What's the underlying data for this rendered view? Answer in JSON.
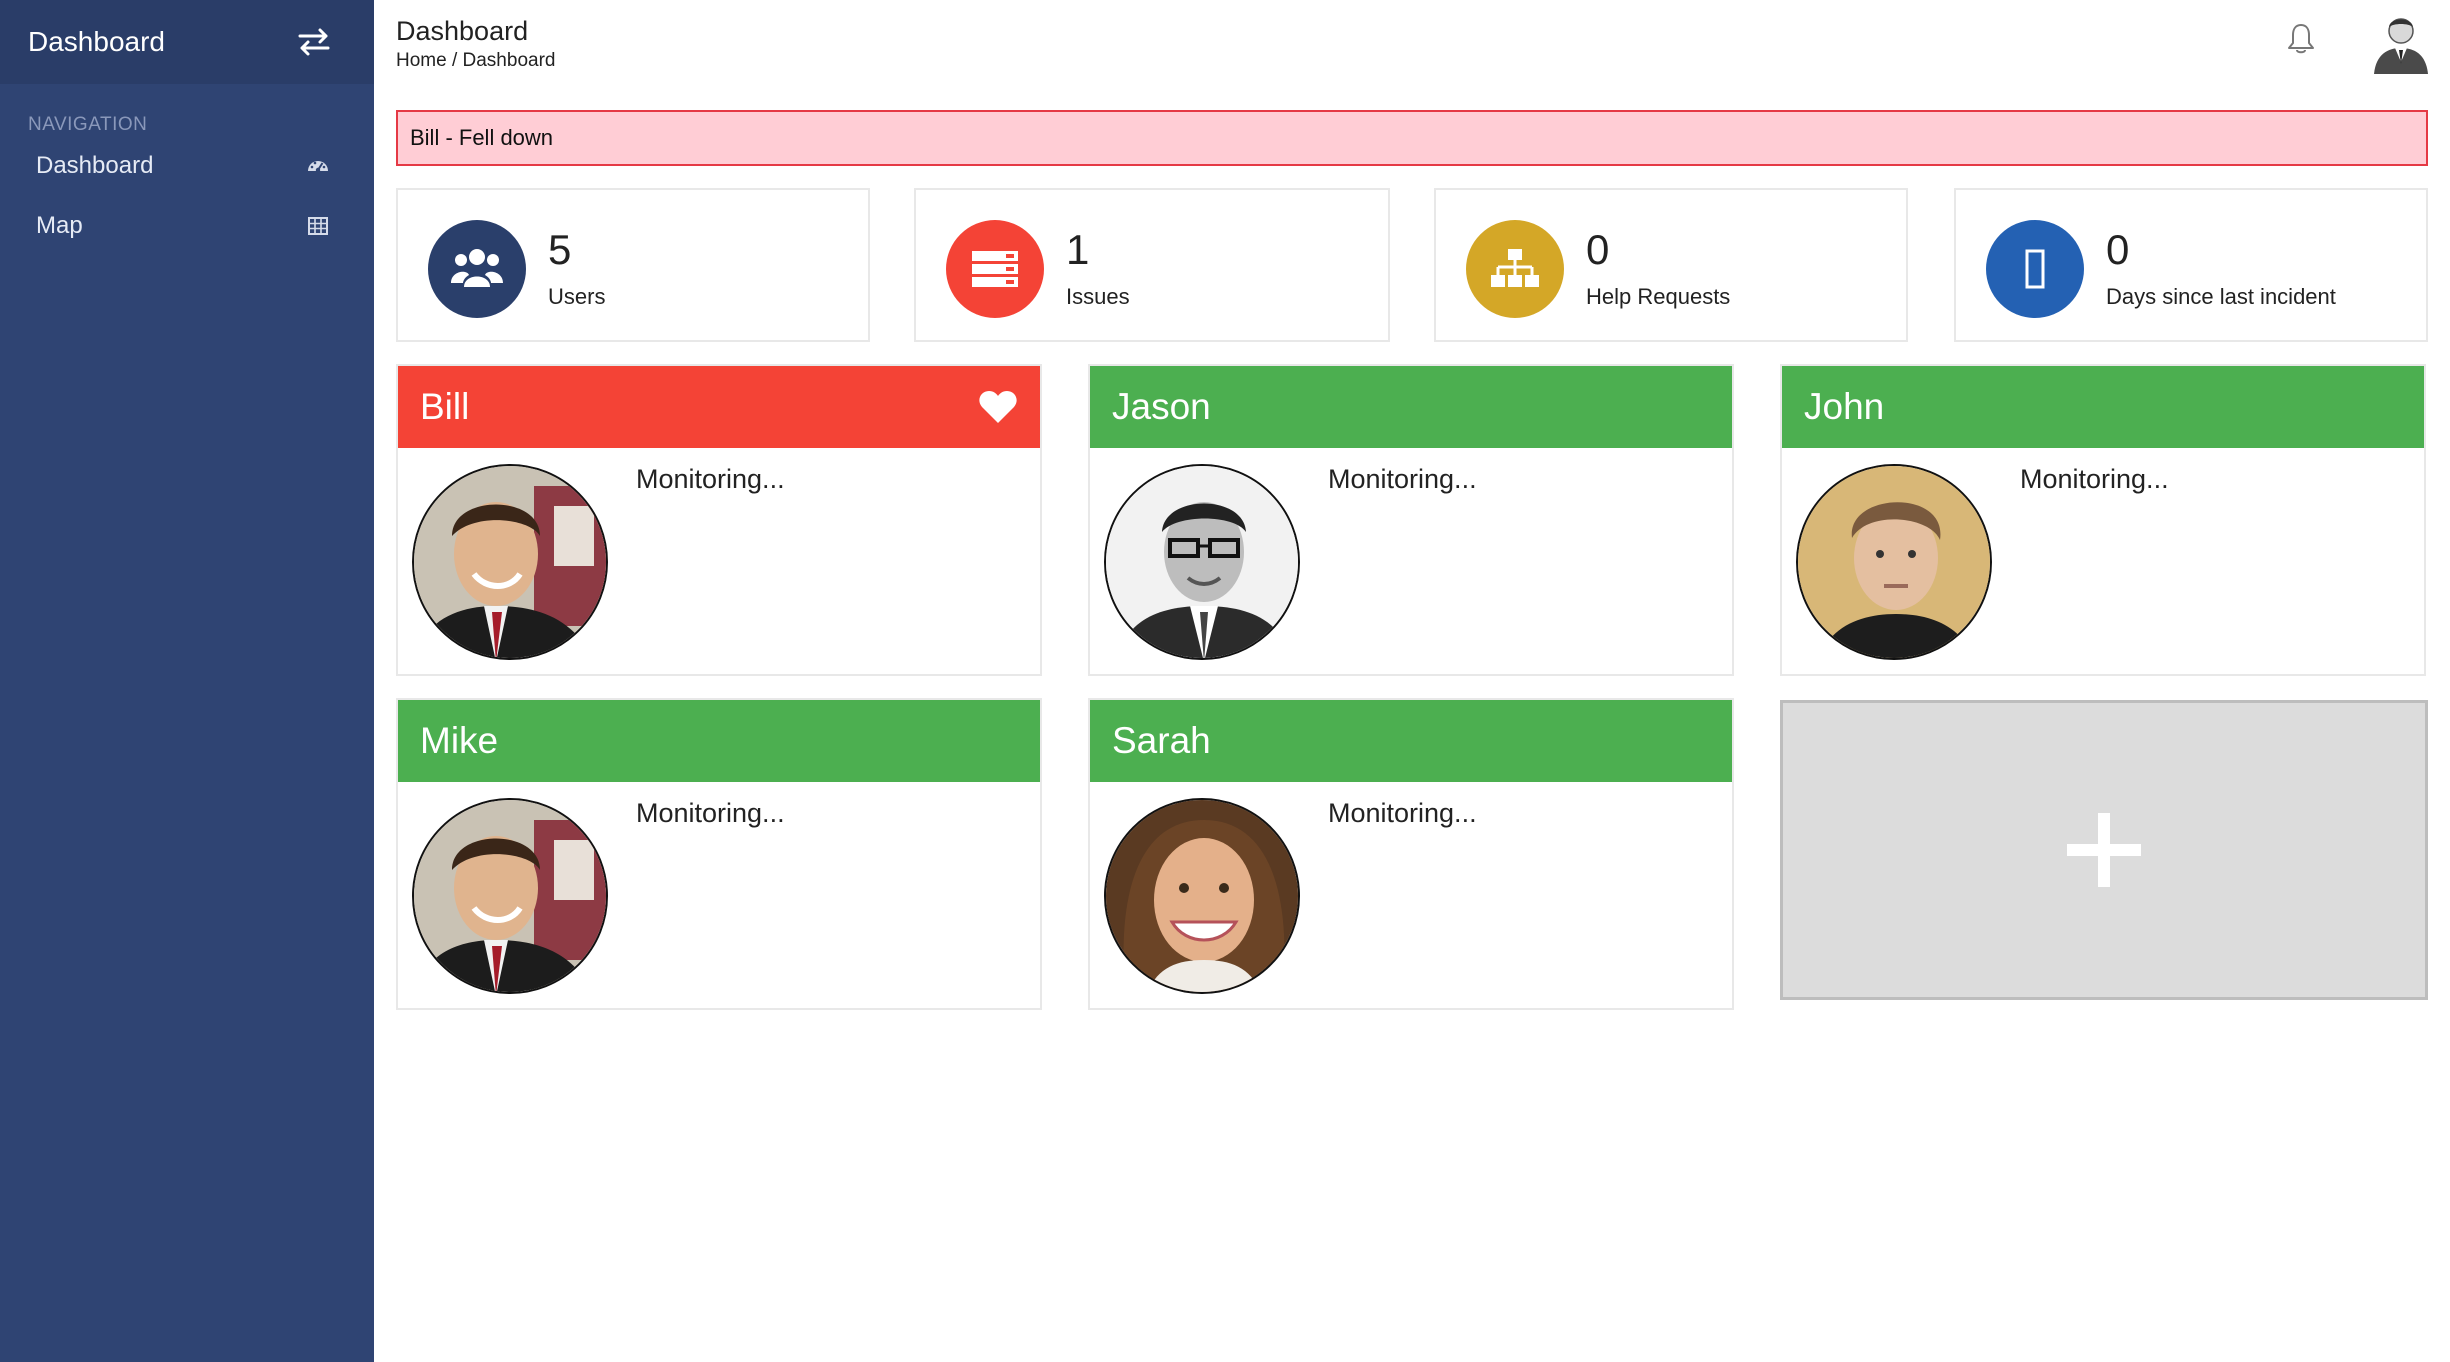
{
  "sidebar": {
    "title": "Dashboard",
    "section": "NAVIGATION",
    "items": [
      {
        "label": "Dashboard",
        "icon": "dashboard-gauge-icon"
      },
      {
        "label": "Map",
        "icon": "grid-table-icon"
      }
    ]
  },
  "header": {
    "title": "Dashboard",
    "breadcrumb": "Home / Dashboard"
  },
  "alert": {
    "text": "Bill - Fell down"
  },
  "stats": [
    {
      "value": "5",
      "label": "Users",
      "icon": "users-icon",
      "color": "#2a3f6b"
    },
    {
      "value": "1",
      "label": "Issues",
      "icon": "server-icon",
      "color": "#f44336"
    },
    {
      "value": "0",
      "label": "Help Requests",
      "icon": "sitemap-icon",
      "color": "#d4a727"
    },
    {
      "value": "0",
      "label": "Days since last incident",
      "icon": "blank-box-icon",
      "color": "#2461b3"
    }
  ],
  "people": [
    {
      "name": "Bill",
      "status": "Monitoring...",
      "state": "alarm",
      "heart": true
    },
    {
      "name": "Jason",
      "status": "Monitoring...",
      "state": "ok"
    },
    {
      "name": "John",
      "status": "Monitoring...",
      "state": "ok"
    },
    {
      "name": "Mike",
      "status": "Monitoring...",
      "state": "ok"
    },
    {
      "name": "Sarah",
      "status": "Monitoring...",
      "state": "ok"
    }
  ],
  "colors": {
    "sidebar": "#2f4473",
    "ok": "#4caf50",
    "alarm": "#f44336",
    "alert_bg": "#ffcdd5",
    "alert_border": "#e53945"
  }
}
